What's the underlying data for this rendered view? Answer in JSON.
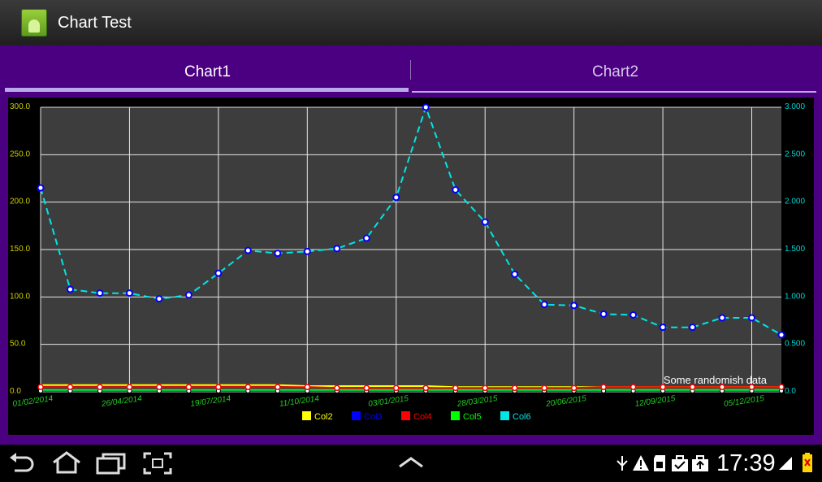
{
  "app": {
    "title": "Chart Test"
  },
  "tabs": [
    {
      "label": "Chart1"
    },
    {
      "label": "Chart2"
    }
  ],
  "status": {
    "time": "17:39"
  },
  "colors": {
    "background": "#4b0082",
    "plot": "#3d3d3d",
    "left_axis": "#cccc00",
    "right_axis": "#00d4d4",
    "x_labels": "#22cc22"
  },
  "chart_data": {
    "type": "line",
    "title": "Some randomish data",
    "x_tick_labels": [
      "01/02/2014",
      "26/04/2014",
      "19/07/2014",
      "11/10/2014",
      "03/01/2015",
      "28/03/2015",
      "20/06/2015",
      "12/09/2015",
      "05/12/2015"
    ],
    "ylim_left": [
      0,
      300
    ],
    "y_ticks_left": [
      "0.0",
      "50.0",
      "100.0",
      "150.0",
      "200.0",
      "250.0",
      "300.0"
    ],
    "ylim_right": [
      0,
      3
    ],
    "y_ticks_right": [
      "0.0",
      "0.500",
      "1.000",
      "1.500",
      "2.000",
      "2.500",
      "3.000"
    ],
    "grid": true,
    "legend_position": "bottom",
    "x": [
      "01/02/2014",
      "01/03/2014",
      "29/03/2014",
      "26/04/2014",
      "24/05/2014",
      "21/06/2014",
      "19/07/2014",
      "16/08/2014",
      "13/09/2014",
      "11/10/2014",
      "08/11/2014",
      "06/12/2014",
      "03/01/2015",
      "31/01/2015",
      "28/02/2015",
      "28/03/2015",
      "25/04/2015",
      "23/05/2015",
      "20/06/2015",
      "18/07/2015",
      "15/08/2015",
      "12/09/2015",
      "10/10/2015",
      "07/11/2015",
      "05/12/2015",
      "02/01/2016"
    ],
    "series": [
      {
        "name": "Col2",
        "color": "#ffff00",
        "axis": "left",
        "values": [
          7,
          7,
          7,
          7,
          7,
          7,
          7,
          7,
          7,
          6,
          6,
          6,
          6,
          6,
          5,
          5,
          5,
          5,
          5,
          5,
          5,
          5,
          5,
          5,
          5,
          5
        ]
      },
      {
        "name": "Col3",
        "color": "#0000ff",
        "axis": "left",
        "values": [
          1,
          1,
          1,
          1,
          1,
          1,
          1,
          1,
          1,
          1,
          1,
          1,
          1,
          1,
          1,
          1,
          1,
          1,
          1,
          1,
          1,
          1,
          1,
          1,
          1,
          1
        ]
      },
      {
        "name": "Col4",
        "color": "#ff0000",
        "axis": "left",
        "values": [
          5,
          5,
          5,
          5,
          5,
          5,
          5,
          5,
          5,
          5,
          4,
          4,
          4,
          4,
          4,
          4,
          4,
          4,
          4,
          5,
          5,
          5,
          5,
          5,
          5,
          5
        ]
      },
      {
        "name": "Col5",
        "color": "#00ff00",
        "axis": "left",
        "values": [
          2,
          2,
          2,
          2,
          2,
          2,
          2,
          2,
          2,
          2,
          2,
          2,
          2,
          2,
          2,
          2,
          2,
          2,
          2,
          2,
          2,
          2,
          2,
          2,
          2,
          2
        ]
      },
      {
        "name": "Col6",
        "color": "#00e5e5",
        "axis": "right",
        "values": [
          2.15,
          1.08,
          1.04,
          1.04,
          0.98,
          1.02,
          1.25,
          1.49,
          1.46,
          1.48,
          1.51,
          1.62,
          2.05,
          3.0,
          2.13,
          1.79,
          1.24,
          0.92,
          0.91,
          0.82,
          0.81,
          0.68,
          0.68,
          0.78,
          0.78,
          0.6
        ]
      }
    ]
  }
}
